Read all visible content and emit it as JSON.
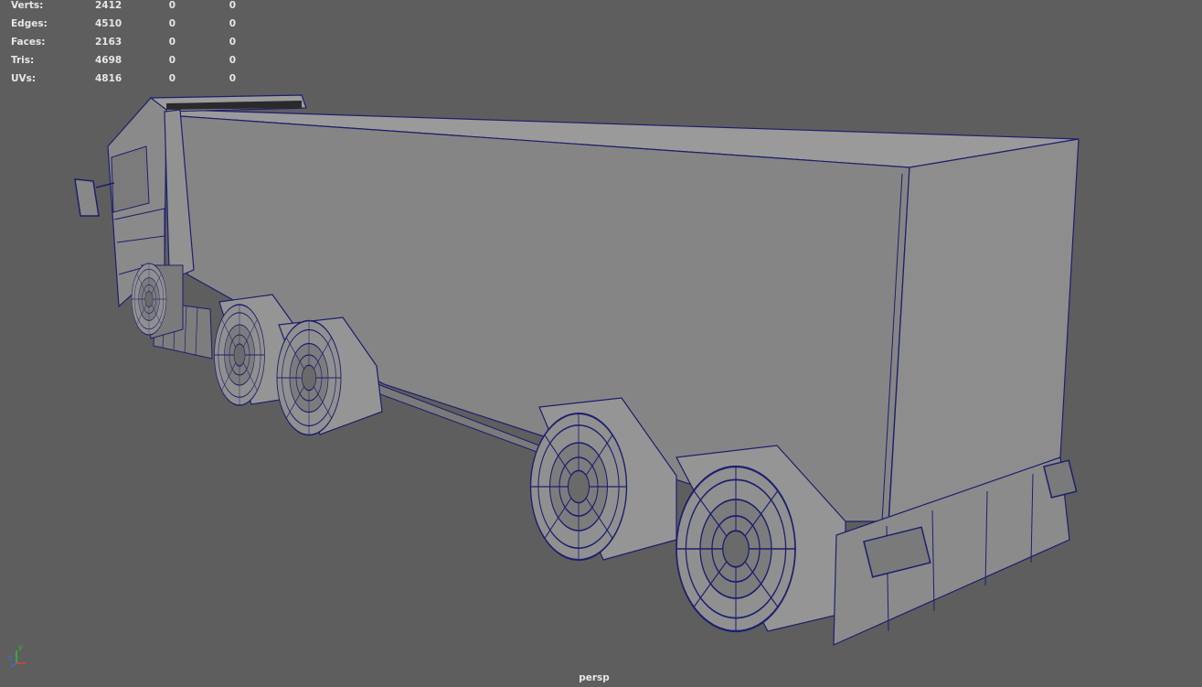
{
  "stats": [
    {
      "label": "Verts:",
      "values": [
        "2412",
        "0",
        "0"
      ]
    },
    {
      "label": "Edges:",
      "values": [
        "4510",
        "0",
        "0"
      ]
    },
    {
      "label": "Faces:",
      "values": [
        "2163",
        "0",
        "0"
      ]
    },
    {
      "label": "Tris:",
      "values": [
        "4698",
        "0",
        "0"
      ]
    },
    {
      "label": "UVs:",
      "values": [
        "4816",
        "0",
        "0"
      ]
    }
  ],
  "camera_label": "persp",
  "axis": {
    "y": "y",
    "z": "z"
  },
  "colors": {
    "background": "#5e5e5e",
    "surface": "#8a8a8a",
    "surface_light": "#999999",
    "surface_dark": "#6e6e6e",
    "wireframe": "#1c1f6e",
    "hud_text": "#e6e6e6"
  }
}
